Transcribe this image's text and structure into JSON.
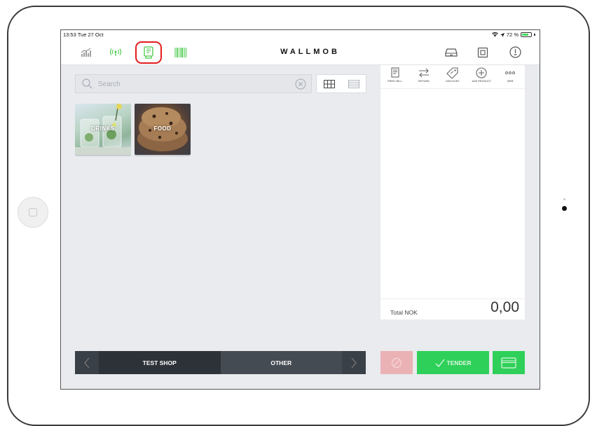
{
  "status_bar": {
    "time": "13:53",
    "date": "Tue 27 Oct",
    "battery": "72 %",
    "battery_level": 0.72
  },
  "topbar": {
    "logo": "WALLMOB",
    "left_icons": [
      "stats-icon",
      "signal-broadcast-icon",
      "receipt-printer-icon",
      "barcode-icon"
    ],
    "right_icons": [
      "cash-drawer-icon",
      "register-icon",
      "user-account-icon"
    ],
    "highlighted_icon": "receipt-printer-icon",
    "highlight_color": "#e21d1d",
    "accent_green": "#49c94a"
  },
  "search": {
    "placeholder": "Search",
    "value": ""
  },
  "view_toggle": [
    "grid-view-icon",
    "list-view-icon"
  ],
  "categories": [
    {
      "label": "DRINKS"
    },
    {
      "label": "FOOD"
    }
  ],
  "bottom_nav": {
    "tabs": [
      {
        "label": "TEST SHOP",
        "active": true
      },
      {
        "label": "OTHER",
        "active": false
      }
    ]
  },
  "actions": [
    {
      "label": "PRINT BILL",
      "icon": "print-bill-icon"
    },
    {
      "label": "RETURN",
      "icon": "return-arrows-icon"
    },
    {
      "label": "DISCOUNT",
      "icon": "discount-tag-icon"
    },
    {
      "label": "ADD PRODUCT",
      "icon": "add-circle-icon"
    },
    {
      "label": "MER",
      "icon": "more-dots-icon"
    }
  ],
  "total": {
    "label": "Total NOK",
    "value": "0,00"
  },
  "buttons": {
    "tender_label": "TENDER",
    "tender_color": "#2fd05a",
    "cancel_color": "#ebb2b6"
  }
}
